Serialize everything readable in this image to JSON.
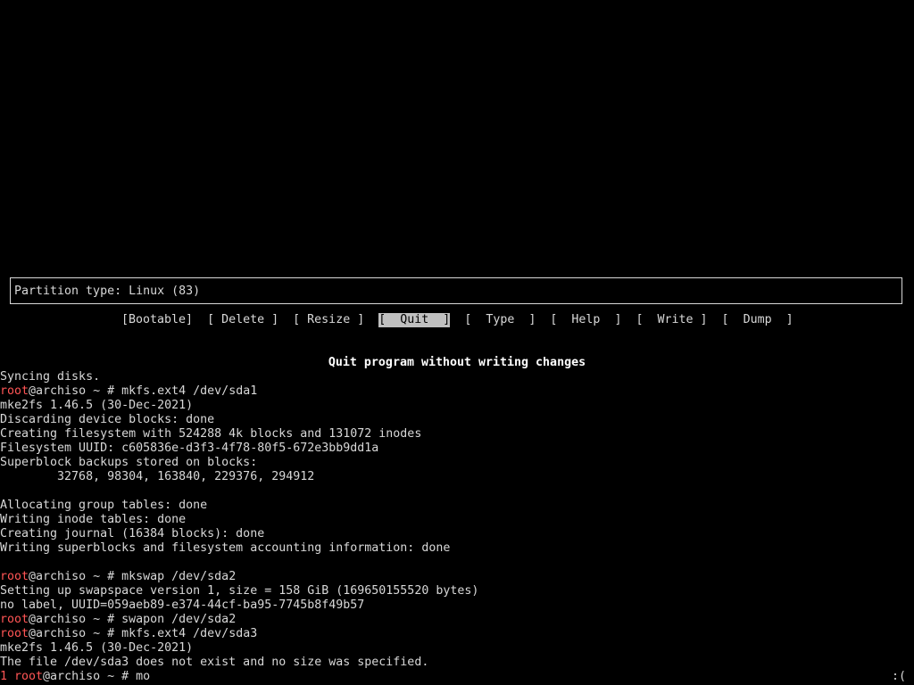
{
  "partition_info": "Partition type: Linux (83)",
  "menu": {
    "bootable": "[Bootable]",
    "delete": "[ Delete ]",
    "resize": "[ Resize ]",
    "quit": "[  Quit  ]",
    "type": "[  Type  ]",
    "help": "[  Help  ]",
    "write": "[  Write ]",
    "dump": "[  Dump  ]"
  },
  "menu_description": "Quit program without writing changes",
  "terminal": {
    "prompt_user": "root",
    "prompt_host_suffix": "@archiso ~ # ",
    "line_01": "Syncing disks.",
    "cmd_01": "mkfs.ext4 /dev/sda1",
    "line_02": "mke2fs 1.46.5 (30-Dec-2021)",
    "line_03": "Discarding device blocks: done",
    "line_04": "Creating filesystem with 524288 4k blocks and 131072 inodes",
    "line_05": "Filesystem UUID: c605836e-d3f3-4f78-80f5-672e3bb9dd1a",
    "line_06": "Superblock backups stored on blocks:",
    "line_07": "        32768, 98304, 163840, 229376, 294912",
    "line_08": "Allocating group tables: done",
    "line_09": "Writing inode tables: done",
    "line_10": "Creating journal (16384 blocks): done",
    "line_11": "Writing superblocks and filesystem accounting information: done",
    "cmd_02": "mkswap /dev/sda2",
    "line_12": "Setting up swapspace version 1, size = 158 GiB (169650155520 bytes)",
    "line_13": "no label, UUID=059aeb89-e374-44cf-ba95-7745b8f49b57",
    "cmd_03": "swapon /dev/sda2",
    "cmd_04": "mkfs.ext4 /dev/sda3",
    "line_14": "mke2fs 1.46.5 (30-Dec-2021)",
    "line_15": "The file /dev/sda3 does not exist and no size was specified.",
    "last_status": "1 ",
    "current_input": "mo",
    "right_status": ":("
  },
  "colors": {
    "background": "#000000",
    "text": "#d8d8d8",
    "prompt_user": "#ff5555",
    "menu_selected_bg": "#c0c0c0"
  }
}
